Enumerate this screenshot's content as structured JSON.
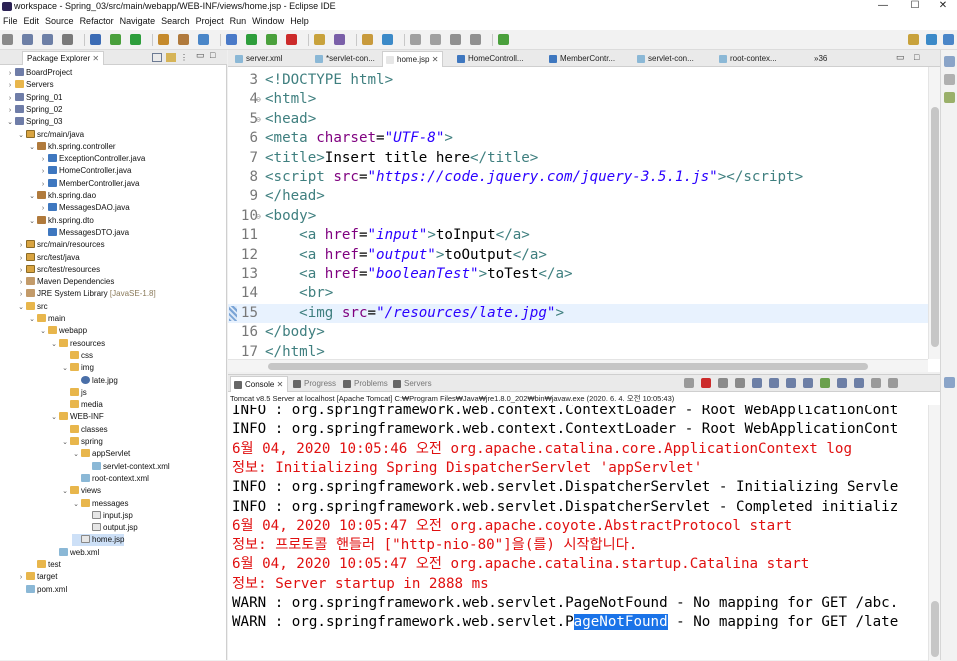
{
  "window": {
    "title": "workspace - Spring_03/src/main/webapp/WEB-INF/views/home.jsp - Eclipse IDE",
    "minimize": "—",
    "maximize": "☐",
    "close": "✕"
  },
  "menu": [
    "File",
    "Edit",
    "Source",
    "Refactor",
    "Navigate",
    "Search",
    "Project",
    "Run",
    "Window",
    "Help"
  ],
  "package_explorer": {
    "tab_label": "Package Explorer",
    "items": [
      {
        "label": "BoardProject",
        "depth": 0,
        "icon": "project",
        "expanded": false
      },
      {
        "label": "Servers",
        "depth": 0,
        "icon": "folder",
        "expanded": false
      },
      {
        "label": "Spring_01",
        "depth": 0,
        "icon": "project",
        "expanded": false
      },
      {
        "label": "Spring_02",
        "depth": 0,
        "icon": "project",
        "expanded": false
      },
      {
        "label": "Spring_03",
        "depth": 0,
        "icon": "project",
        "expanded": true
      },
      {
        "label": "src/main/java",
        "depth": 1,
        "icon": "srcfolder",
        "expanded": true
      },
      {
        "label": "kh.spring.controller",
        "depth": 2,
        "icon": "pkg",
        "expanded": true
      },
      {
        "label": "ExceptionController.java",
        "depth": 3,
        "icon": "java",
        "expanded": false
      },
      {
        "label": "HomeController.java",
        "depth": 3,
        "icon": "java",
        "expanded": false
      },
      {
        "label": "MemberController.java",
        "depth": 3,
        "icon": "java",
        "expanded": false
      },
      {
        "label": "kh.spring.dao",
        "depth": 2,
        "icon": "pkg",
        "expanded": true
      },
      {
        "label": "MessagesDAO.java",
        "depth": 3,
        "icon": "java",
        "expanded": false
      },
      {
        "label": "kh.spring.dto",
        "depth": 2,
        "icon": "pkg",
        "expanded": true
      },
      {
        "label": "MessagesDTO.java",
        "depth": 3,
        "icon": "java",
        "expanded": null
      },
      {
        "label": "src/main/resources",
        "depth": 1,
        "icon": "srcfolder",
        "expanded": false
      },
      {
        "label": "src/test/java",
        "depth": 1,
        "icon": "srcfolder",
        "expanded": false
      },
      {
        "label": "src/test/resources",
        "depth": 1,
        "icon": "srcfolder",
        "expanded": false
      },
      {
        "label": "Maven Dependencies",
        "depth": 1,
        "icon": "lib",
        "expanded": false
      },
      {
        "label": "JRE System Library",
        "depth": 1,
        "icon": "lib",
        "expanded": false,
        "suffix": "[JavaSE-1.8]"
      },
      {
        "label": "src",
        "depth": 1,
        "icon": "folder",
        "expanded": true
      },
      {
        "label": "main",
        "depth": 2,
        "icon": "folder",
        "expanded": true
      },
      {
        "label": "webapp",
        "depth": 3,
        "icon": "folder",
        "expanded": true
      },
      {
        "label": "resources",
        "depth": 4,
        "icon": "folder",
        "expanded": true
      },
      {
        "label": "css",
        "depth": 5,
        "icon": "folder",
        "expanded": null
      },
      {
        "label": "img",
        "depth": 5,
        "icon": "folder",
        "expanded": true
      },
      {
        "label": "late.jpg",
        "depth": 6,
        "icon": "img",
        "expanded": null
      },
      {
        "label": "js",
        "depth": 5,
        "icon": "folder",
        "expanded": null
      },
      {
        "label": "media",
        "depth": 5,
        "icon": "folder",
        "expanded": null
      },
      {
        "label": "WEB-INF",
        "depth": 4,
        "icon": "folder",
        "expanded": true
      },
      {
        "label": "classes",
        "depth": 5,
        "icon": "folder",
        "expanded": null
      },
      {
        "label": "spring",
        "depth": 5,
        "icon": "folder",
        "expanded": true
      },
      {
        "label": "appServlet",
        "depth": 6,
        "icon": "folder",
        "expanded": true
      },
      {
        "label": "servlet-context.xml",
        "depth": 7,
        "icon": "xml",
        "expanded": null
      },
      {
        "label": "root-context.xml",
        "depth": 6,
        "icon": "xml",
        "expanded": null
      },
      {
        "label": "views",
        "depth": 5,
        "icon": "folder",
        "expanded": true
      },
      {
        "label": "messages",
        "depth": 6,
        "icon": "folder",
        "expanded": true
      },
      {
        "label": "input.jsp",
        "depth": 7,
        "icon": "jsp",
        "expanded": null
      },
      {
        "label": "output.jsp",
        "depth": 7,
        "icon": "jsp",
        "expanded": null
      },
      {
        "label": "home.jsp",
        "depth": 6,
        "icon": "jsp",
        "expanded": null,
        "selected": true
      },
      {
        "label": "web.xml",
        "depth": 4,
        "icon": "xml",
        "expanded": null
      },
      {
        "label": "test",
        "depth": 2,
        "icon": "folder",
        "expanded": null
      },
      {
        "label": "target",
        "depth": 1,
        "icon": "folder",
        "expanded": false
      },
      {
        "label": "pom.xml",
        "depth": 1,
        "icon": "xml",
        "expanded": null
      }
    ]
  },
  "editor": {
    "tabs": [
      {
        "label": "server.xml",
        "active": false
      },
      {
        "label": "*servlet-con...",
        "active": false
      },
      {
        "label": "home.jsp",
        "active": true
      },
      {
        "label": "HomeControll...",
        "active": false
      },
      {
        "label": "MemberContr...",
        "active": false
      },
      {
        "label": "servlet-con...",
        "active": false
      },
      {
        "label": "root-contex...",
        "active": false
      }
    ],
    "overflow_label": "»36",
    "lines": [
      {
        "n": "3",
        "fold": "",
        "html": "<span class='tag'>&lt;!DOCTYPE html&gt;</span>",
        "current": false
      },
      {
        "n": "4",
        "fold": "⊖",
        "html": "<span class='tag'>&lt;html&gt;</span>",
        "current": false
      },
      {
        "n": "5",
        "fold": "⊖",
        "html": "<span class='tag'>&lt;head&gt;</span>",
        "current": false
      },
      {
        "n": "6",
        "fold": "",
        "html": "<span class='tag'>&lt;meta </span><span class='attr'>charset</span>=<span class='str'>\"UTF-8\"</span><span class='tag'>&gt;</span>",
        "current": false
      },
      {
        "n": "7",
        "fold": "",
        "html": "<span class='tag'>&lt;title&gt;</span>Insert title here<span class='tag'>&lt;/title&gt;</span>",
        "current": false
      },
      {
        "n": "8",
        "fold": "",
        "html": "<span class='tag'>&lt;script </span><span class='attr'>src</span>=<span class='str'>\"https://code.jquery.com/jquery-3.5.1.js\"</span><span class='tag'>&gt;&lt;/script&gt;</span>",
        "current": false
      },
      {
        "n": "9",
        "fold": "",
        "html": "<span class='tag'>&lt;/head&gt;</span>",
        "current": false
      },
      {
        "n": "10",
        "fold": "⊖",
        "html": "<span class='tag'>&lt;body&gt;</span>",
        "current": false
      },
      {
        "n": "11",
        "fold": "",
        "html": "    <span class='tag'>&lt;a </span><span class='attr'>href</span>=<span class='str'>\"input\"</span><span class='tag'>&gt;</span>toInput<span class='tag'>&lt;/a&gt;</span>",
        "current": false
      },
      {
        "n": "12",
        "fold": "",
        "html": "    <span class='tag'>&lt;a </span><span class='attr'>href</span>=<span class='str'>\"output\"</span><span class='tag'>&gt;</span>toOutput<span class='tag'>&lt;/a&gt;</span>",
        "current": false
      },
      {
        "n": "13",
        "fold": "",
        "html": "    <span class='tag'>&lt;a </span><span class='attr'>href</span>=<span class='str'>\"booleanTest\"</span><span class='tag'>&gt;</span>toTest<span class='tag'>&lt;/a&gt;</span>",
        "current": false
      },
      {
        "n": "14",
        "fold": "",
        "html": "    <span class='tag'>&lt;br&gt;</span>",
        "current": false
      },
      {
        "n": "15",
        "fold": "",
        "html": "    <span class='tag'>&lt;img </span><span class='attr'>src</span>=<span class='str'>\"/resources/late.jpg\"</span><span class='tag'>&gt;</span>",
        "current": true
      },
      {
        "n": "16",
        "fold": "",
        "html": "<span class='tag'>&lt;/body&gt;</span>",
        "current": false
      },
      {
        "n": "17",
        "fold": "",
        "html": "<span class='tag'>&lt;/html&gt;</span>",
        "current": false
      }
    ]
  },
  "console": {
    "tabs": [
      {
        "label": "Console",
        "active": true
      },
      {
        "label": "Progress",
        "active": false
      },
      {
        "label": "Problems",
        "active": false
      },
      {
        "label": "Servers",
        "active": false
      }
    ],
    "description": "Tomcat v8.5 Server at localhost [Apache Tomcat] C:₩Program Files₩Java₩jre1.8.0_202₩bin₩javaw.exe (2020. 6. 4. 오전 10:05:43)",
    "lines": [
      {
        "color": "black",
        "text": "INFO : org.springframework.web.context.ContextLoader - Root WebApplicationCont"
      },
      {
        "color": "black",
        "text": "INFO : org.springframework.web.context.ContextLoader - Root WebApplicationCont"
      },
      {
        "color": "red",
        "text": "6월 04, 2020 10:05:46 오전 org.apache.catalina.core.ApplicationContext log"
      },
      {
        "color": "red",
        "text": "정보: Initializing Spring DispatcherServlet 'appServlet'"
      },
      {
        "color": "black",
        "text": "INFO : org.springframework.web.servlet.DispatcherServlet - Initializing Servle"
      },
      {
        "color": "black",
        "text": "INFO : org.springframework.web.servlet.DispatcherServlet - Completed initializ"
      },
      {
        "color": "red",
        "text": "6월 04, 2020 10:05:47 오전 org.apache.coyote.AbstractProtocol start"
      },
      {
        "color": "red",
        "text": "정보: 프로토콜 핸들러 [\"http-nio-80\"]을(를) 시작합니다."
      },
      {
        "color": "red",
        "text": "6월 04, 2020 10:05:47 오전 org.apache.catalina.startup.Catalina start"
      },
      {
        "color": "red",
        "text": "정보: Server startup in 2888 ms"
      },
      {
        "color": "black",
        "text": "WARN : org.springframework.web.servlet.PageNotFound - No mapping for GET /abc."
      },
      {
        "color": "black",
        "text": "WARN : org.springframework.web.servlet.P",
        "highlight": "ageNotFound",
        "after": " - No mapping for GET /late"
      }
    ]
  },
  "colors": {
    "tag": "#3f7f7f",
    "attribute": "#7f007f",
    "string": "#2a00ff",
    "console_error": "#e01010",
    "selection": "#1a73e8"
  }
}
